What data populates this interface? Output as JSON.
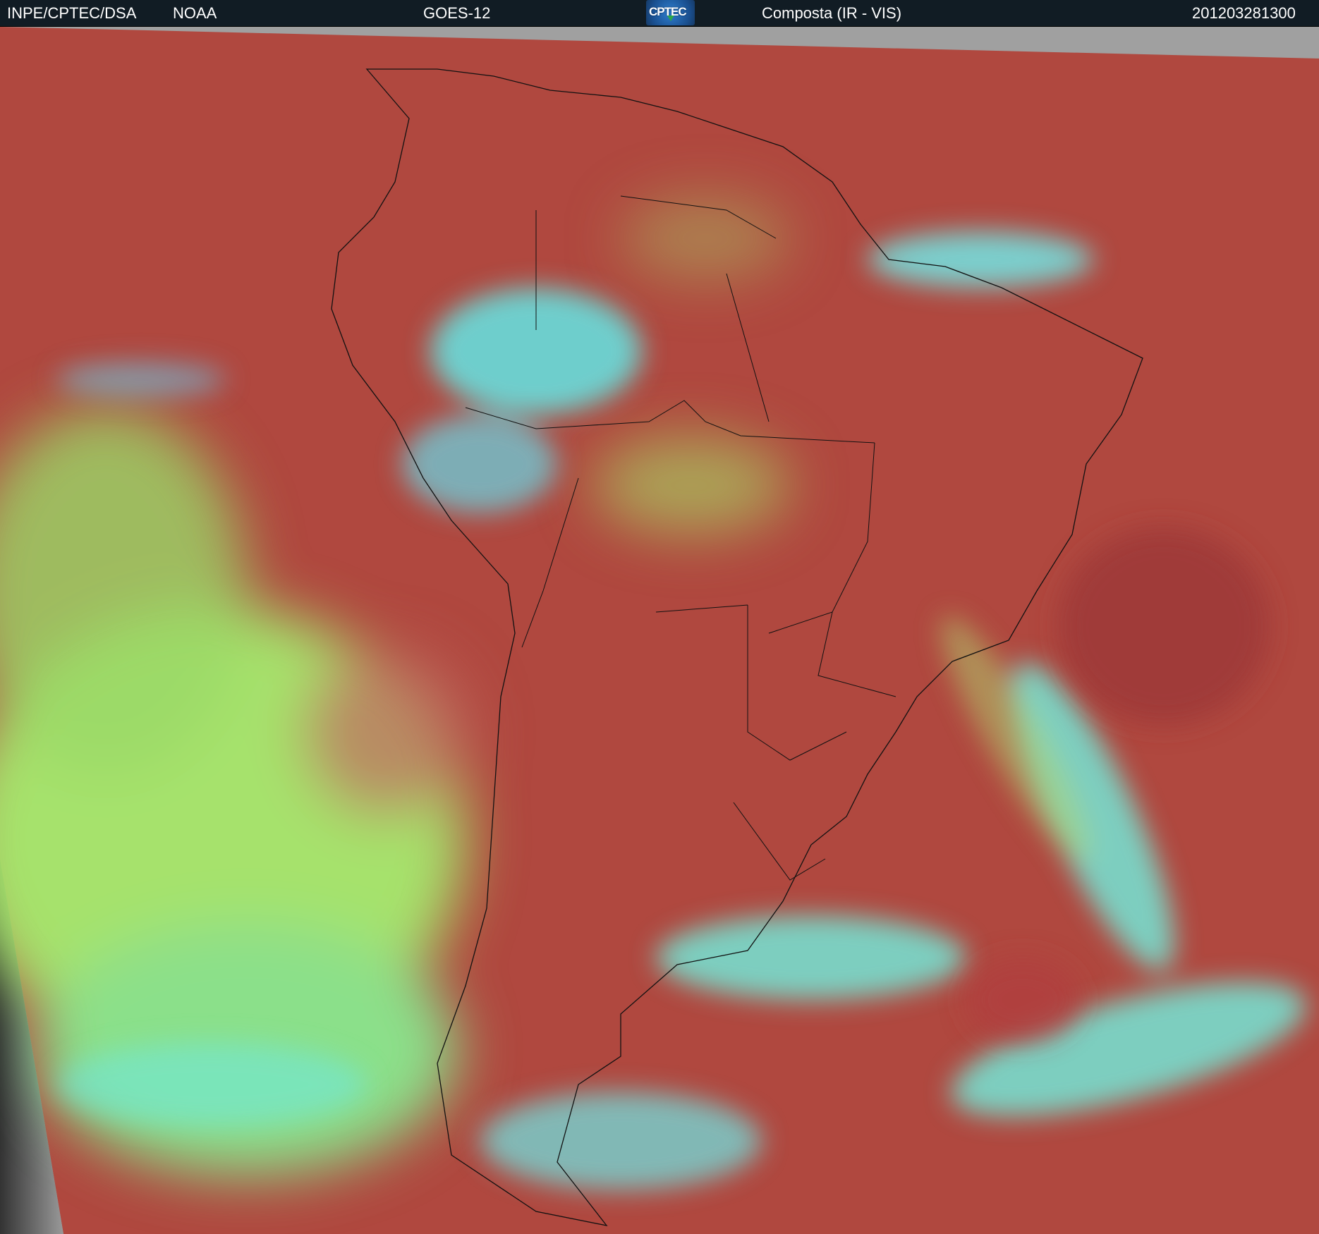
{
  "header": {
    "institution": "INPE/CPTEC/DSA",
    "agency": "NOAA",
    "satellite": "GOES-12",
    "logo_text": "CPTEC",
    "product": "Composta (IR - VIS)",
    "timestamp": "201203281300"
  },
  "colors": {
    "header_bg": "#111c24",
    "land_clear": "#b0483f",
    "low_cloud": "#a6e26c",
    "high_cloud": "#5ef0f0",
    "no_data": "#a0a0a0"
  }
}
